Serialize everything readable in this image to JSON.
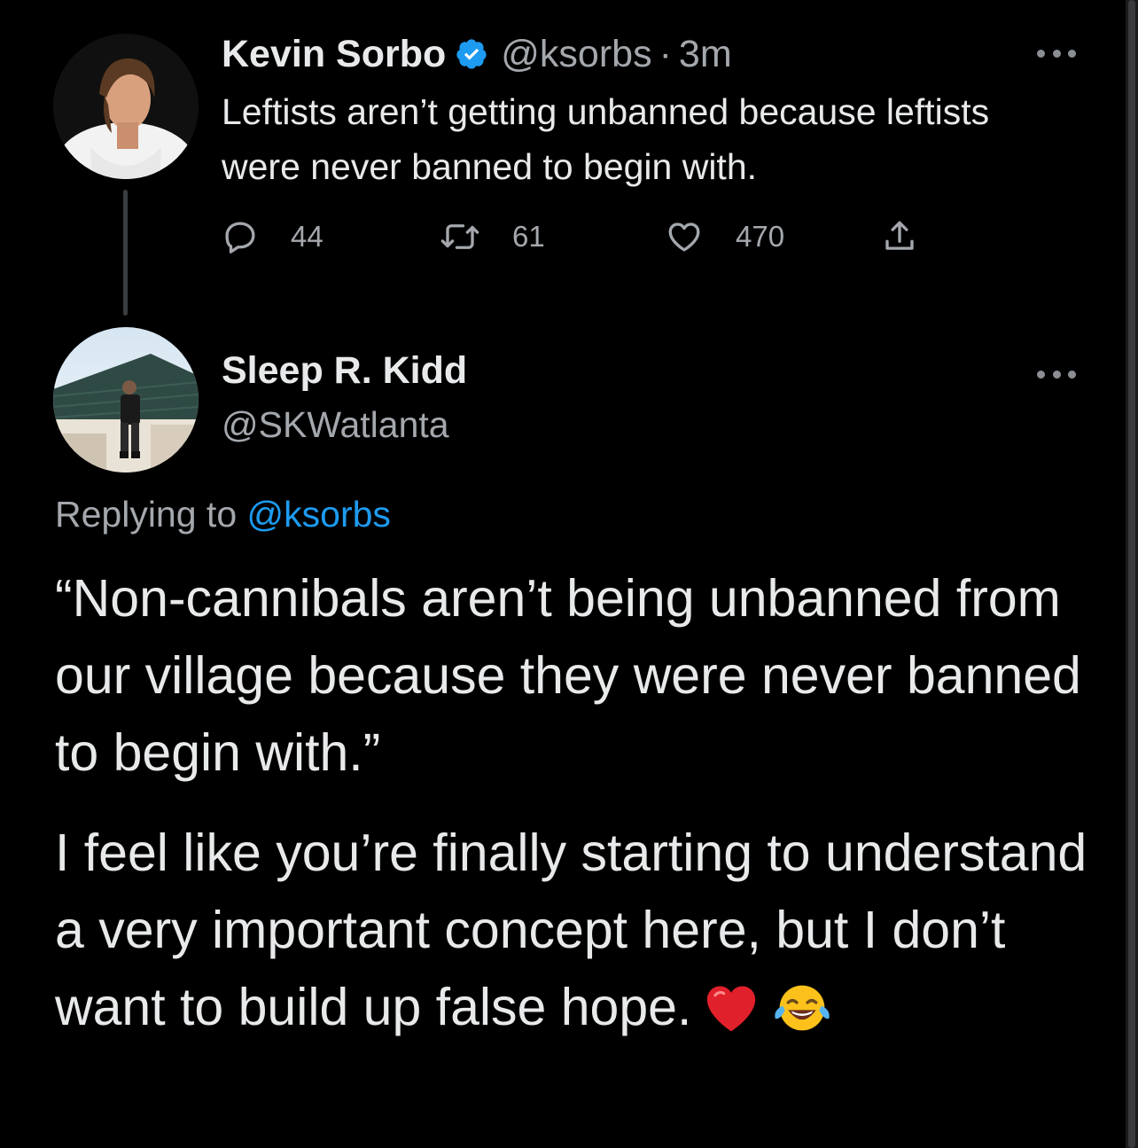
{
  "tweet": {
    "author_name": "Kevin Sorbo",
    "handle": "@ksorbs",
    "separator": "·",
    "time": "3m",
    "text": "Leftists aren’t getting unbanned because leftists were never banned to begin with.",
    "replies": "44",
    "retweets": "61",
    "likes": "470",
    "verified_color": "#1d9bf0"
  },
  "reply": {
    "author_name": "Sleep R. Kidd",
    "handle": "@SKWatlanta",
    "replying_label": "Replying to",
    "replying_mention": "@ksorbs",
    "paragraph_1": "“Non-cannibals aren’t being unbanned from our village because they were never banned to begin with.”",
    "paragraph_2": "I feel like you’re finally starting to understand a very important concept here, but I don’t want to build up false hope.",
    "emojis": [
      "red-heart-icon",
      "face-with-tears-of-joy-icon"
    ]
  },
  "colors": {
    "background": "#000000",
    "text": "#e7e9ea",
    "secondary": "#a4a8ad",
    "accent": "#1d9bf0"
  }
}
